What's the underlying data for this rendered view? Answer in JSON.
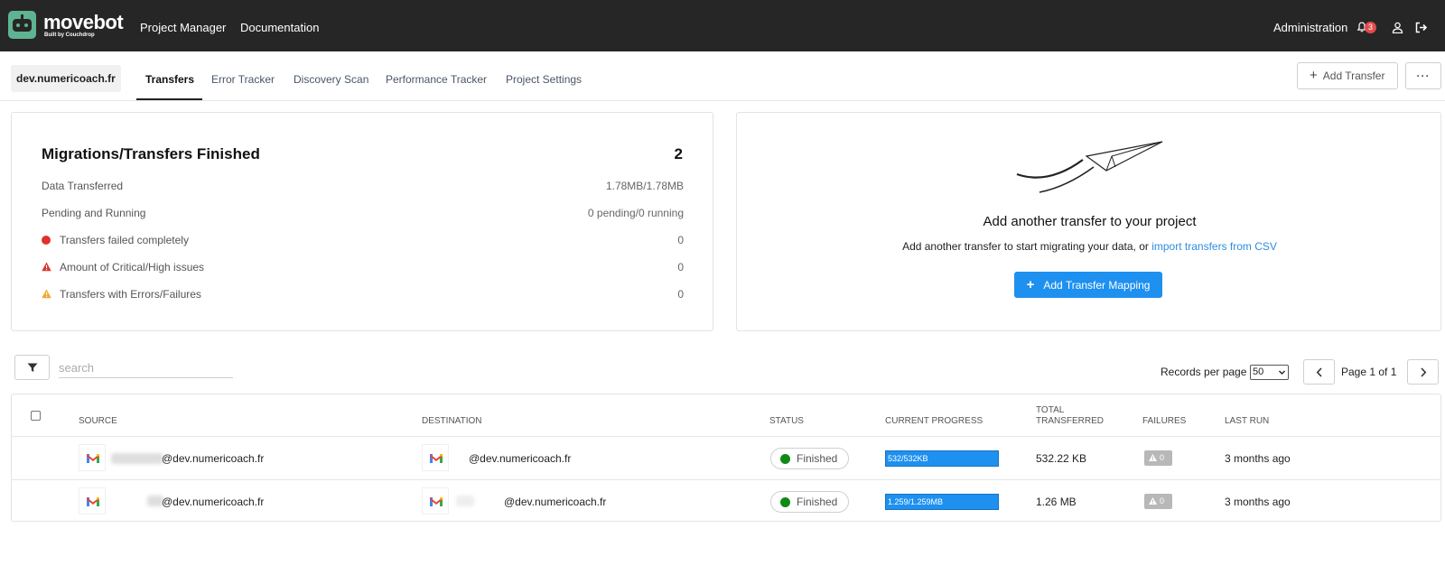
{
  "app": {
    "brand": "movebot",
    "brand_sub": "Built by Couchdrop",
    "nav": {
      "project_manager": "Project Manager",
      "documentation": "Documentation",
      "administration": "Administration"
    },
    "notifications_count": "3"
  },
  "project": {
    "name": "dev.numericoach.fr",
    "tabs": [
      {
        "label": "Transfers",
        "active": true
      },
      {
        "label": "Error Tracker"
      },
      {
        "label": "Discovery Scan"
      },
      {
        "label": "Performance Tracker"
      },
      {
        "label": "Project Settings"
      }
    ],
    "add_transfer_button": "Add Transfer",
    "more_button": "···"
  },
  "summary": {
    "title": "Migrations/Transfers Finished",
    "total": "2",
    "rows": [
      {
        "label": "Data Transferred",
        "value": "1.78MB/1.78MB"
      },
      {
        "label": "Pending and Running",
        "value": "0 pending/0 running"
      },
      {
        "label": "Transfers failed completely",
        "value": "0",
        "icon": "red-dot-icon"
      },
      {
        "label": "Amount of Critical/High issues",
        "value": "0",
        "icon": "critical-warning-icon",
        "color": "#d9362b"
      },
      {
        "label": "Transfers with Errors/Failures",
        "value": "0",
        "icon": "warning-icon",
        "color": "#f0a82a"
      }
    ]
  },
  "add_panel": {
    "title": "Add another transfer to your project",
    "desc_prefix": "Add another transfer to start migrating your data, or",
    "desc_link": "import transfers from CSV",
    "button": "Add Transfer Mapping"
  },
  "toolbar": {
    "search_placeholder": "search",
    "records_per_page_label": "Records per page",
    "records_per_page_value": "50",
    "page_label": "Page 1 of 1"
  },
  "table": {
    "headers": {
      "source": "SOURCE",
      "destination": "DESTINATION",
      "status": "STATUS",
      "current_progress": "CURRENT PROGRESS",
      "total_transferred_line1": "TOTAL",
      "total_transferred_line2": "TRANSFERRED",
      "failures": "FAILURES",
      "last_run": "LAST RUN"
    },
    "rows": [
      {
        "source": "@dev.numericoach.fr",
        "destination": "@dev.numericoach.fr",
        "status": "Finished",
        "progress_label": "532/532KB",
        "progress_fraction": 1.0,
        "total": "532.22 KB",
        "failures": "0",
        "last_run": "3 months ago"
      },
      {
        "source": "@dev.numericoach.fr",
        "destination": "@dev.numericoach.fr",
        "status": "Finished",
        "progress_label": "1.259/1.259MB",
        "progress_fraction": 1.0,
        "total": "1.26 MB",
        "failures": "0",
        "last_run": "3 months ago"
      }
    ]
  },
  "colors": {
    "accent": "#1e90f0",
    "topbar": "#262626",
    "logo": "#5fb393",
    "status_ok": "#0f8a17",
    "error": "#e0312a"
  }
}
